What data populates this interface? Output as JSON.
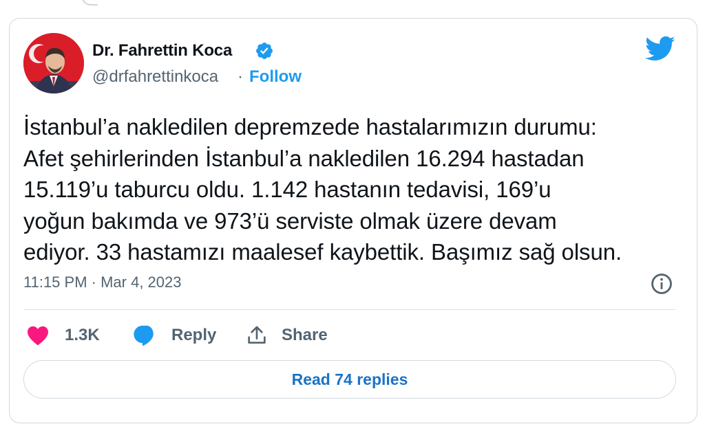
{
  "author": {
    "name": "Dr. Fahrettin Koca",
    "handle": "@drfahrettinkoca",
    "separator": "·",
    "follow_label": "Follow"
  },
  "tweet": {
    "lines": [
      "İstanbul’a nakledilen depremzede hastalarımızın durumu:",
      "Afet şehirlerinden İstanbul’a nakledilen 16.294 hastadan",
      "15.119’u taburcu oldu. 1.142 hastanın tedavisi, 169’u",
      "yoğun bakımda ve 973’ü serviste olmak üzere devam",
      "ediyor. 33 hastamızı maalesef kaybettik. Başımız sağ olsun."
    ],
    "timestamp": "11:15 PM · Mar 4, 2023"
  },
  "actions": {
    "likes": "1.3K",
    "reply_label": "Reply",
    "share_label": "Share"
  },
  "read_replies_label": "Read 74 replies",
  "icons": [
    "verified-badge-icon",
    "twitter-bird-icon",
    "info-icon",
    "heart-icon",
    "reply-bubble-icon",
    "share-icon"
  ],
  "colors": {
    "accent": "#1d9bf0",
    "like": "#f91880",
    "text": "#0f1419",
    "secondary": "#536471"
  }
}
